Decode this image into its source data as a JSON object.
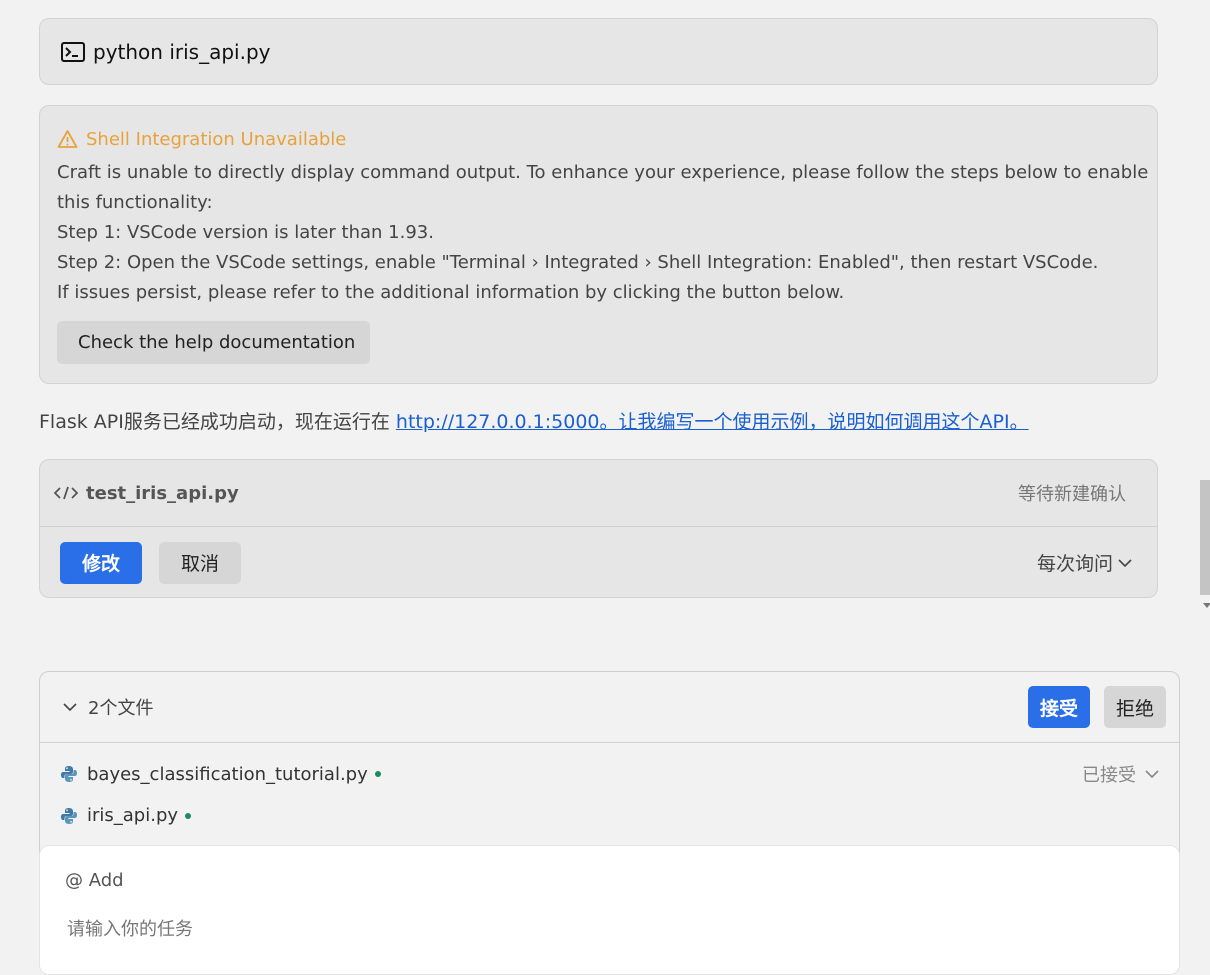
{
  "command": {
    "text": "python iris_api.py",
    "icon": "terminal-icon"
  },
  "warning": {
    "icon": "warning-icon",
    "color": "#e8a23a",
    "title": "Shell Integration Unavailable",
    "lines": [
      "Craft is unable to directly display command output. To enhance your experience, please follow the steps below to enable",
      "this functionality:",
      "Step 1: VSCode version is later than 1.93.",
      "Step 2: Open the VSCode settings, enable \"Terminal › Integrated › Shell Integration: Enabled\", then restart VSCode.",
      "If issues persist, please refer to the additional information by clicking the button below."
    ],
    "help_button": "Check the help documentation"
  },
  "status": {
    "prefix": "Flask API服务已经成功启动，现在运行在 ",
    "link": "http://127.0.0.1:5000。让我编写一个使用示例，说明如何调用这个API。"
  },
  "file_card": {
    "icon": "code-icon",
    "filename": "test_iris_api.py",
    "pending_label": "等待新建确认",
    "modify_label": "修改",
    "cancel_label": "取消",
    "ask_label": "每次询问",
    "accent": "#2a6ee8"
  },
  "changes": {
    "count_label": "2个文件",
    "accept_label": "接受",
    "reject_label": "拒绝",
    "files": [
      {
        "name": "bayes_classification_tutorial.py",
        "status": "已接受"
      },
      {
        "name": "iris_api.py",
        "status": ""
      }
    ]
  },
  "input": {
    "mention_label": "@ Add",
    "placeholder": "请输入你的任务"
  }
}
